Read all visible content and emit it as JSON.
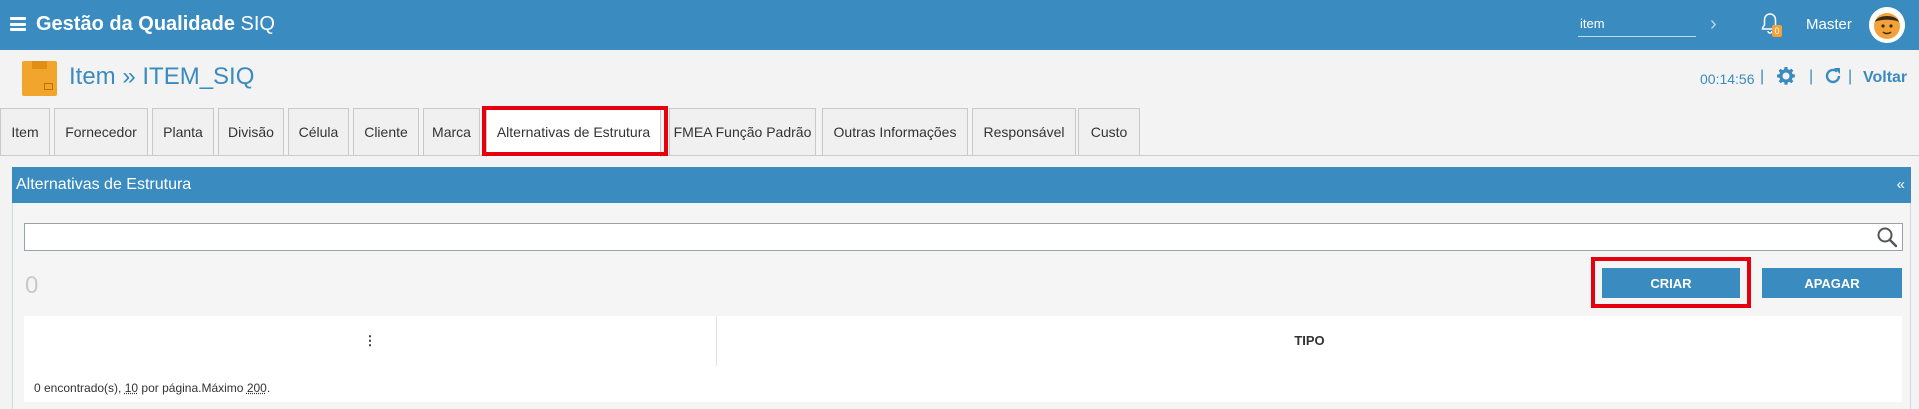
{
  "topbar": {
    "app_name_bold": "Gestão da Qualidade",
    "app_name_suffix": " SIQ",
    "search_value": "item",
    "notification_count": "0",
    "user_name": "Master"
  },
  "header": {
    "breadcrumb": "Item » ITEM_SIQ",
    "clock": "00:14:56",
    "separator": "|",
    "back_label": "Voltar"
  },
  "tabs": [
    {
      "label": "Item"
    },
    {
      "label": "Fornecedor"
    },
    {
      "label": "Planta"
    },
    {
      "label": "Divisão"
    },
    {
      "label": "Célula"
    },
    {
      "label": "Cliente"
    },
    {
      "label": "Marca"
    },
    {
      "label": "Alternativas de Estrutura"
    },
    {
      "label": "FMEA Função Padrão"
    },
    {
      "label": "Outras Informações"
    },
    {
      "label": "Responsável"
    },
    {
      "label": "Custo"
    }
  ],
  "panel": {
    "title": "Alternativas de Estrutura",
    "collapse_symbol": "«",
    "search_value": "",
    "record_count": "0",
    "create_label": "CRIAR",
    "delete_label": "APAGAR",
    "columns": [
      {
        "label": "⋮"
      },
      {
        "label": "TIPO"
      }
    ],
    "footer": {
      "found": "0 encontrado(s), ",
      "per_page_value": "10",
      "per_page_text": " por página.Máximo ",
      "max_value": "200",
      "end": "."
    }
  },
  "colors": {
    "primary": "#3a8bbf",
    "highlight": "#e6000d",
    "item_icon": "#f2a52d"
  },
  "icons": [
    "menu-icon",
    "chevron-right-icon",
    "bell-icon",
    "gear-icon",
    "refresh-icon",
    "search-icon",
    "box-icon"
  ]
}
